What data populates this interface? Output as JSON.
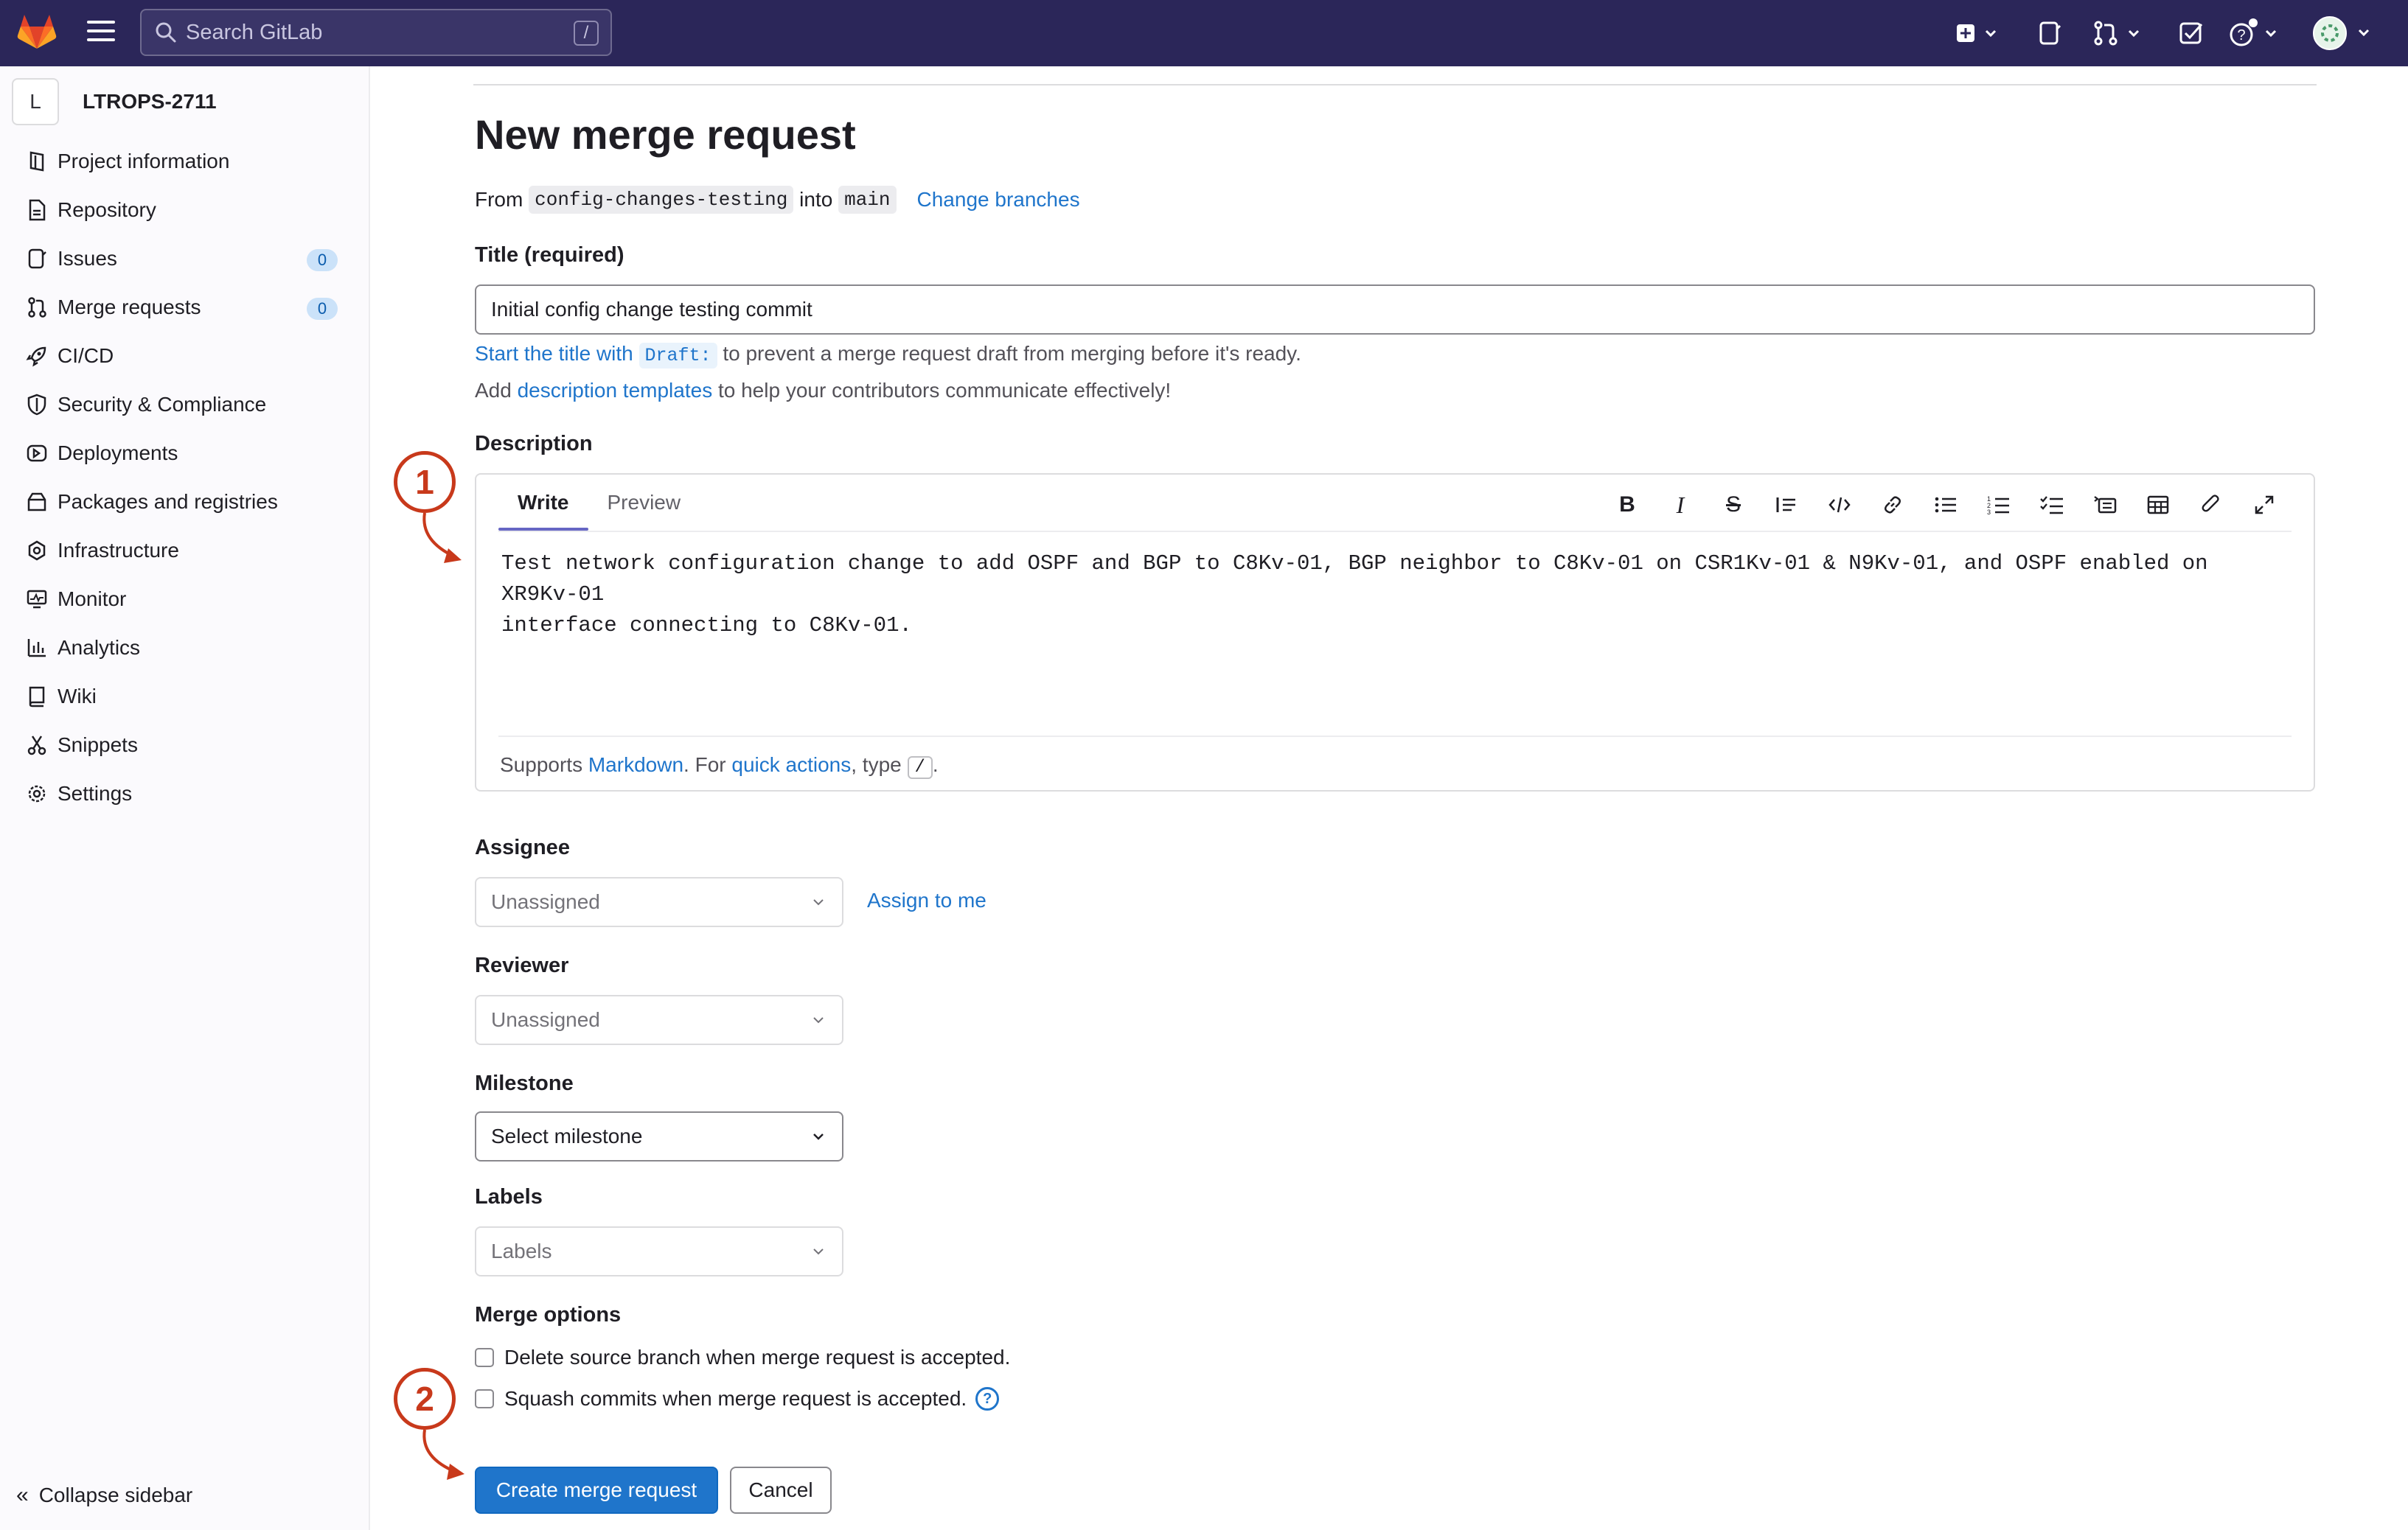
{
  "topbar": {
    "search_placeholder": "Search GitLab",
    "search_shortcut": "/"
  },
  "sidebar": {
    "project_initial": "L",
    "project_name": "LTROPS-2711",
    "items": [
      {
        "label": "Project information",
        "icon": "project-info-icon"
      },
      {
        "label": "Repository",
        "icon": "document-icon"
      },
      {
        "label": "Issues",
        "icon": "issues-icon",
        "badge": "0"
      },
      {
        "label": "Merge requests",
        "icon": "merge-request-icon",
        "badge": "0"
      },
      {
        "label": "CI/CD",
        "icon": "rocket-icon"
      },
      {
        "label": "Security & Compliance",
        "icon": "shield-icon"
      },
      {
        "label": "Deployments",
        "icon": "deployments-icon"
      },
      {
        "label": "Packages and registries",
        "icon": "package-icon"
      },
      {
        "label": "Infrastructure",
        "icon": "cloud-gear-icon"
      },
      {
        "label": "Monitor",
        "icon": "monitor-icon"
      },
      {
        "label": "Analytics",
        "icon": "chart-icon"
      },
      {
        "label": "Wiki",
        "icon": "book-icon"
      },
      {
        "label": "Snippets",
        "icon": "scissors-icon"
      },
      {
        "label": "Settings",
        "icon": "gear-icon"
      }
    ],
    "collapse_label": "Collapse sidebar"
  },
  "page": {
    "title": "New merge request",
    "from_label": "From",
    "source_branch": "config-changes-testing",
    "into_label": "into",
    "target_branch": "main",
    "change_branches": "Change branches"
  },
  "form": {
    "title_label": "Title (required)",
    "title_value": "Initial config change testing commit",
    "draft_link": "Start the title with",
    "draft_code": "Draft:",
    "draft_rest": "to prevent a merge request draft from merging before it's ready.",
    "templates_pre": "Add",
    "templates_link": "description templates",
    "templates_post": "to help your contributors communicate effectively!",
    "description_label": "Description",
    "tab_write": "Write",
    "tab_preview": "Preview",
    "description_text": "Test network configuration change to add OSPF and BGP to C8Kv-01, BGP neighbor to C8Kv-01 on CSR1Kv-01 & N9Kv-01, and OSPF enabled on XR9Kv-01\ninterface connecting to C8Kv-01.",
    "supports": "Supports",
    "markdown_link": "Markdown",
    "for_text": ". For",
    "quick_actions_link": "quick actions",
    "type_text": ", type",
    "slash_key": "/",
    "period": ".",
    "assignee_label": "Assignee",
    "assignee_value": "Unassigned",
    "assign_me": "Assign to me",
    "reviewer_label": "Reviewer",
    "reviewer_value": "Unassigned",
    "milestone_label": "Milestone",
    "milestone_value": "Select milestone",
    "labels_label": "Labels",
    "labels_value": "Labels",
    "merge_options_label": "Merge options",
    "delete_branch": "Delete source branch when merge request is accepted.",
    "squash_commits": "Squash commits when merge request is accepted.",
    "help_mark": "?",
    "create_button": "Create merge request",
    "cancel_button": "Cancel"
  },
  "annotations": {
    "one": "1",
    "two": "2"
  },
  "colors": {
    "topbar": "#2b2659",
    "primary": "#1f75cb",
    "annotation": "#c8391b"
  }
}
